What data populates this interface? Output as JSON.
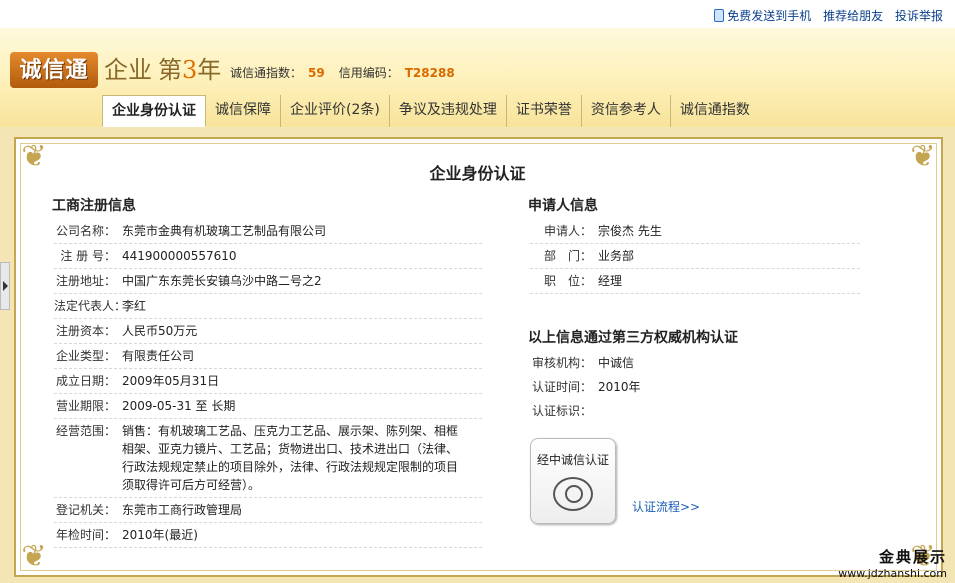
{
  "topbar": {
    "send_to_phone": "免费发送到手机",
    "recommend": "推荐给朋友",
    "report": "投诉举报"
  },
  "header": {
    "logo_text": "诚信通",
    "enterprise_label": "企业",
    "year_prefix": "第",
    "year_num": "3",
    "year_suffix": "年",
    "index_label": "诚信通指数：",
    "index_value": "59",
    "code_label": "信用编码：",
    "code_value": "T28288"
  },
  "tabs": [
    {
      "label": "企业身份认证"
    },
    {
      "label": "诚信保障"
    },
    {
      "label": "企业评价(2条)"
    },
    {
      "label": "争议及违规处理"
    },
    {
      "label": "证书荣誉"
    },
    {
      "label": "资信参考人"
    },
    {
      "label": "诚信通指数"
    }
  ],
  "page_title": "企业身份认证",
  "registration": {
    "title": "工商注册信息",
    "rows": [
      {
        "k": "公司名称：",
        "v": "东莞市金典有机玻璃工艺制品有限公司"
      },
      {
        "k": "注 册 号：",
        "v": "441900000557610"
      },
      {
        "k": "注册地址：",
        "v": "中国广东东莞长安镇乌沙中路二号之2"
      },
      {
        "k": "法定代表人：",
        "v": "李红"
      },
      {
        "k": "注册资本：",
        "v": "人民币50万元"
      },
      {
        "k": "企业类型：",
        "v": "有限责任公司"
      },
      {
        "k": "成立日期：",
        "v": "2009年05月31日"
      },
      {
        "k": "营业期限：",
        "v": "2009-05-31 至 长期"
      },
      {
        "k": "经营范围：",
        "v": "销售：有机玻璃工艺品、压克力工艺品、展示架、陈列架、相框相架、亚克力镜片、工艺品；货物进出口、技术进出口（法律、行政法规规定禁止的项目除外，法律、行政法规规定限制的项目须取得许可后方可经营）。"
      },
      {
        "k": "登记机关：",
        "v": "东莞市工商行政管理局"
      },
      {
        "k": "年检时间：",
        "v": "2010年(最近)"
      }
    ]
  },
  "applicant": {
    "title": "申请人信息",
    "rows": [
      {
        "k": "申请人：",
        "v": "宗俊杰 先生"
      },
      {
        "k": "部　门：",
        "v": "业务部"
      },
      {
        "k": "职　位：",
        "v": "经理"
      }
    ]
  },
  "certification": {
    "title": "以上信息通过第三方权威机构认证",
    "rows": [
      {
        "k": "审核机构：",
        "v": "中诚信"
      },
      {
        "k": "认证时间：",
        "v": "2010年"
      },
      {
        "k": "认证标识：",
        "v": ""
      }
    ],
    "badge_text": "经中诚信认证",
    "flow_link": "认证流程>>"
  },
  "watermark": {
    "line1": "金典展示",
    "line2": "www.jdzhanshi.com"
  },
  "colors": {
    "accent_orange": "#e07000",
    "frame_gold": "#c4a552",
    "link_blue": "#1a5fb4"
  }
}
